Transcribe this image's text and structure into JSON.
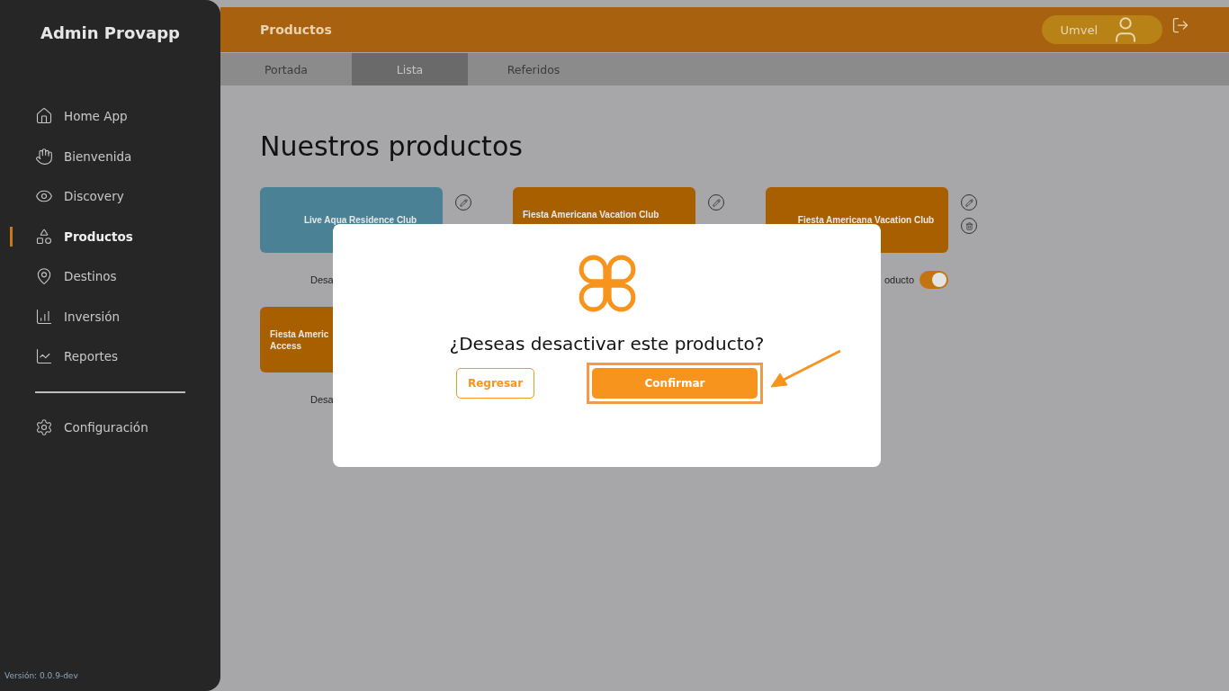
{
  "sidebar": {
    "title": "Admin Provapp",
    "items": [
      {
        "label": "Home App",
        "selected": false
      },
      {
        "label": "Bienvenida",
        "selected": false
      },
      {
        "label": "Discovery",
        "selected": false
      },
      {
        "label": "Productos",
        "selected": true
      },
      {
        "label": "Destinos",
        "selected": false
      },
      {
        "label": "Inversión",
        "selected": false
      },
      {
        "label": "Reportes",
        "selected": false
      }
    ],
    "footer_items": [
      {
        "label": "Configuración",
        "selected": false
      }
    ],
    "version": "Versión: 0.0.9-dev"
  },
  "header": {
    "title": "Productos",
    "user": "Umvel"
  },
  "tabs": [
    {
      "label": "Portada",
      "selected": false
    },
    {
      "label": "Lista",
      "selected": true
    },
    {
      "label": "Referidos",
      "selected": false
    }
  ],
  "page_title": "Nuestros productos",
  "products": [
    {
      "kind": "centered",
      "lines": [
        "Live Aqua Residence Club"
      ],
      "color": "#4a8194",
      "actions": [
        {
          "kind": "edit"
        }
      ],
      "toggle_label": "Desa"
    },
    {
      "kind": "stacked",
      "lines": [
        "Fiesta Americana Vacation Club"
      ],
      "color": "#a85f00",
      "actions": [
        {
          "kind": "edit"
        }
      ]
    },
    {
      "kind": "centered",
      "lines": [
        "Fiesta Americana Vacation Club"
      ],
      "color": "#a85f00",
      "actions": [
        {
          "kind": "edit"
        },
        {
          "kind": "delete"
        }
      ],
      "toggle_label": "oducto",
      "toggle": {
        "on": true
      }
    },
    {
      "kind": "stacked",
      "lines": [
        "Fiesta Americ",
        "Access"
      ],
      "color": "#a85f00",
      "toggle_label": "Desa"
    }
  ],
  "dialog": {
    "question": "¿Deseas desactivar este producto?",
    "buttons": [
      {
        "label": "Regresar",
        "kind": "secondary",
        "highlighted": false
      },
      {
        "label": "Confirmar",
        "kind": "primary",
        "highlighted": true
      }
    ]
  }
}
